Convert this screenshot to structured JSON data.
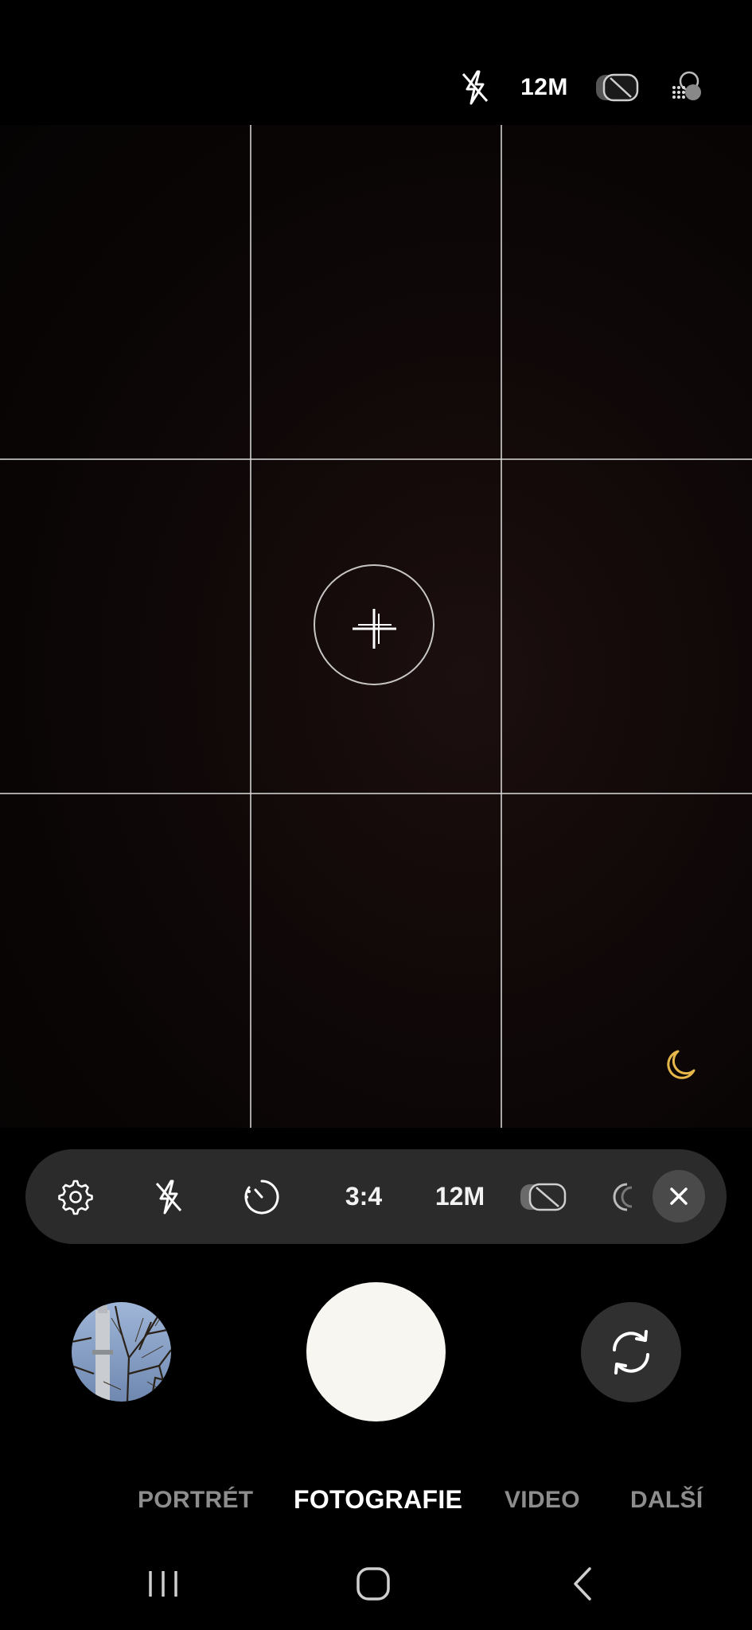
{
  "top_bar": {
    "flash_icon": "flash-off-icon",
    "resolution": "12M",
    "motion_icon": "motion-photo-off-icon",
    "filter_icon": "filters-icon"
  },
  "viewfinder": {
    "grid": "3x3",
    "focus_icon": "focus-plus-icon",
    "scene_icon": "night-mode-moon-icon",
    "scene_color": "#e6b84a"
  },
  "quick_settings": {
    "settings_icon": "gear-icon",
    "flash_icon": "flash-off-icon",
    "timer_icon": "timer-icon",
    "ratio": "3:4",
    "resolution": "12M",
    "motion_icon": "motion-photo-off-icon",
    "close_icon": "close-icon"
  },
  "shutter_row": {
    "gallery_icon": "gallery-thumbnail",
    "shutter": "shutter-button",
    "switch_icon": "switch-camera-icon"
  },
  "modes": [
    {
      "label": "PORTRÉT",
      "active": false
    },
    {
      "label": "FOTOGRAFIE",
      "active": true
    },
    {
      "label": "VIDEO",
      "active": false
    },
    {
      "label": "DALŠÍ",
      "active": false
    }
  ],
  "nav_bar": {
    "recents_icon": "recents-icon",
    "home_icon": "home-icon",
    "back_icon": "back-icon"
  }
}
